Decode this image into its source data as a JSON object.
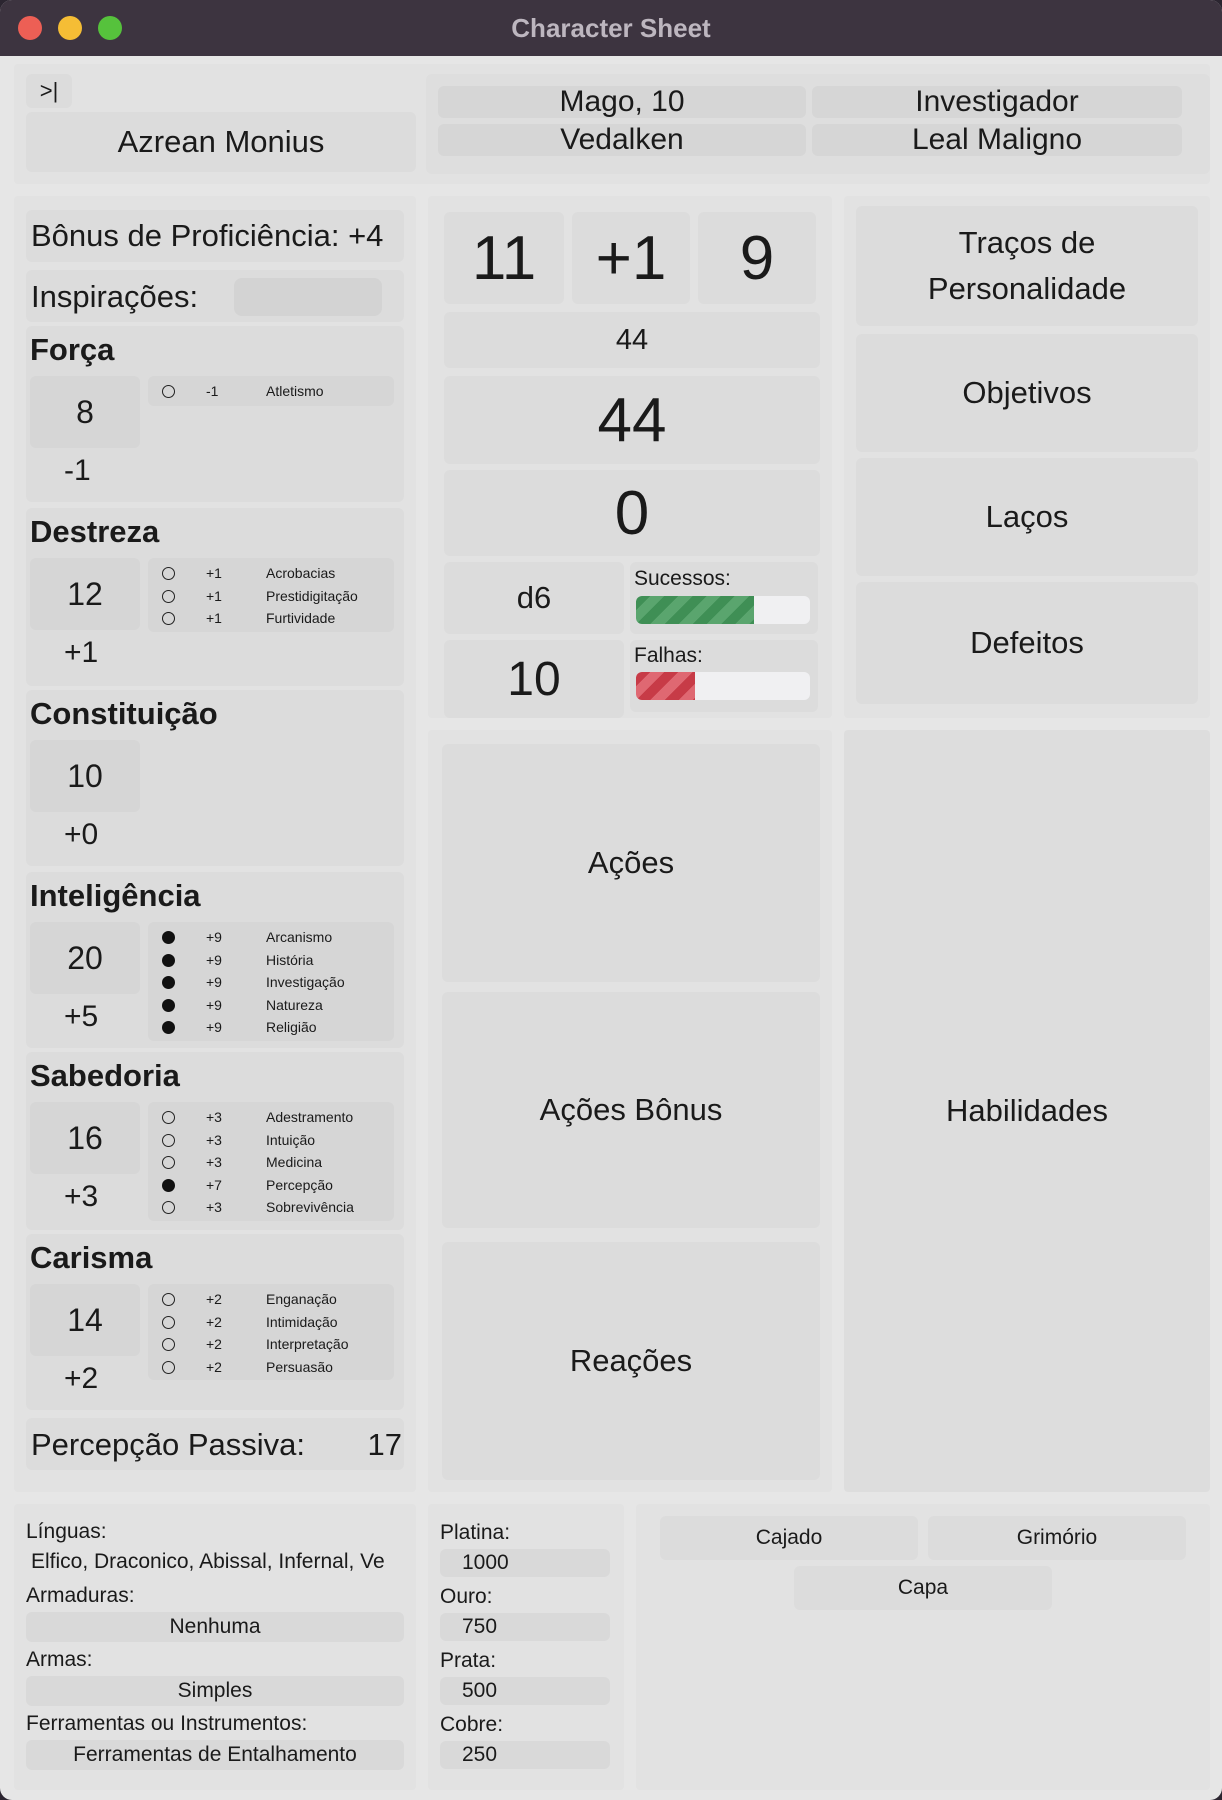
{
  "window": {
    "title": "Character Sheet"
  },
  "header": {
    "toggle_icon": ">|",
    "character_name": "Azrean Monius",
    "class_level": "Mago, 10",
    "background": "Investigador",
    "race": "Vedalken",
    "alignment": "Leal Maligno"
  },
  "left": {
    "proficiency_bonus": "Bônus de Proficiência: +4",
    "inspiration_label": "Inspirações:",
    "inspiration_value": "",
    "abilities": [
      {
        "name": "Força",
        "score": "8",
        "mod": "-1",
        "skills": [
          {
            "bonus": "-1",
            "name": "Atletismo",
            "proficient": false
          }
        ]
      },
      {
        "name": "Destreza",
        "score": "12",
        "mod": "+1",
        "skills": [
          {
            "bonus": "+1",
            "name": "Acrobacias",
            "proficient": false
          },
          {
            "bonus": "+1",
            "name": "Prestidigitação",
            "proficient": false
          },
          {
            "bonus": "+1",
            "name": "Furtividade",
            "proficient": false
          }
        ]
      },
      {
        "name": "Constituição",
        "score": "10",
        "mod": "+0",
        "skills": []
      },
      {
        "name": "Inteligência",
        "score": "20",
        "mod": "+5",
        "skills": [
          {
            "bonus": "+9",
            "name": "Arcanismo",
            "proficient": true
          },
          {
            "bonus": "+9",
            "name": "História",
            "proficient": true
          },
          {
            "bonus": "+9",
            "name": "Investigação",
            "proficient": true
          },
          {
            "bonus": "+9",
            "name": "Natureza",
            "proficient": true
          },
          {
            "bonus": "+9",
            "name": "Religião",
            "proficient": true
          }
        ]
      },
      {
        "name": "Sabedoria",
        "score": "16",
        "mod": "+3",
        "skills": [
          {
            "bonus": "+3",
            "name": "Adestramento",
            "proficient": false
          },
          {
            "bonus": "+3",
            "name": "Intuição",
            "proficient": false
          },
          {
            "bonus": "+3",
            "name": "Medicina",
            "proficient": false
          },
          {
            "bonus": "+7",
            "name": "Percepção",
            "proficient": true
          },
          {
            "bonus": "+3",
            "name": "Sobrevivência",
            "proficient": false
          }
        ]
      },
      {
        "name": "Carisma",
        "score": "14",
        "mod": "+2",
        "skills": [
          {
            "bonus": "+2",
            "name": "Enganação",
            "proficient": false
          },
          {
            "bonus": "+2",
            "name": "Intimidação",
            "proficient": false
          },
          {
            "bonus": "+2",
            "name": "Interpretação",
            "proficient": false
          },
          {
            "bonus": "+2",
            "name": "Persuasão",
            "proficient": false
          }
        ]
      }
    ],
    "passive_perception_label": "Percepção Passiva:",
    "passive_perception_value": "17"
  },
  "combat": {
    "armor_class": "11",
    "initiative": "+1",
    "speed": "9",
    "hp_max": "44",
    "hp_current": "44",
    "hp_temp": "0",
    "hit_dice": "d6",
    "hit_dice_total": "10",
    "death_saves": {
      "successes_label": "Sucessos:",
      "successes_fraction": 0.68,
      "failures_label": "Falhas:",
      "failures_fraction": 0.34
    }
  },
  "personality": {
    "traits": "Traços de Personalidade",
    "ideals": "Objetivos",
    "bonds": "Laços",
    "flaws": "Defeitos"
  },
  "actions": {
    "actions": "Ações",
    "bonus_actions": "Ações Bônus",
    "reactions": "Reações",
    "abilities": "Habilidades"
  },
  "proficiencies": {
    "languages_label": "Línguas:",
    "languages_value": "Elfico, Draconico, Abissal, Infernal, Ve",
    "armor_label": "Armaduras:",
    "armor_value": "Nenhuma",
    "weapons_label": "Armas:",
    "weapons_value": "Simples",
    "tools_label": "Ferramentas ou Instrumentos:",
    "tools_value": "Ferramentas de Entalhamento"
  },
  "currency": {
    "platinum_label": "Platina:",
    "platinum": "1000",
    "gold_label": "Ouro:",
    "gold": "750",
    "silver_label": "Prata:",
    "silver": "500",
    "copper_label": "Cobre:",
    "copper": "250"
  },
  "equipment": {
    "items": [
      "Cajado",
      "Grimório",
      "Capa"
    ]
  }
}
